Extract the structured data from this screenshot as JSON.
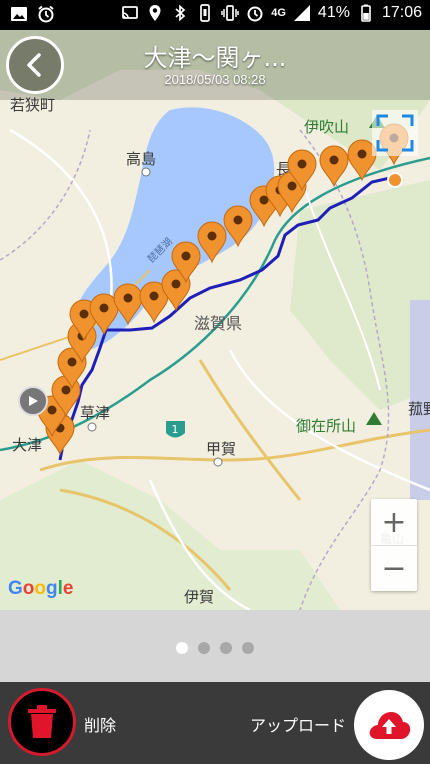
{
  "status_bar": {
    "battery": "41%",
    "time": "17:06",
    "network": "4G"
  },
  "header": {
    "title": "大津〜関ヶ...",
    "date": "2018/05/03 08:28"
  },
  "map": {
    "labels": {
      "wakasa": "若狭町",
      "takashima": "高島",
      "ibukiyama": "伊吹山",
      "nagahama": "長浜",
      "biwako": "琵琶湖",
      "shiga": "滋賀県",
      "kusatsu": "草津",
      "otsu": "大津",
      "gozaisho": "御在所山",
      "koka": "甲賀",
      "kameyama": "亀山",
      "iga": "伊賀",
      "route1": "1",
      "komono": "菰野"
    },
    "route_color": "#1f1fb8",
    "pin_color": "#f0922e",
    "google": "Google"
  },
  "controls": {
    "zoom_in": "+",
    "zoom_out": "−"
  },
  "pager": {
    "pages": 4,
    "active_index": 0
  },
  "actions": {
    "delete_label": "削除",
    "upload_label": "アップロード",
    "delete_color": "#d31b2b",
    "upload_color": "#e0142a"
  }
}
